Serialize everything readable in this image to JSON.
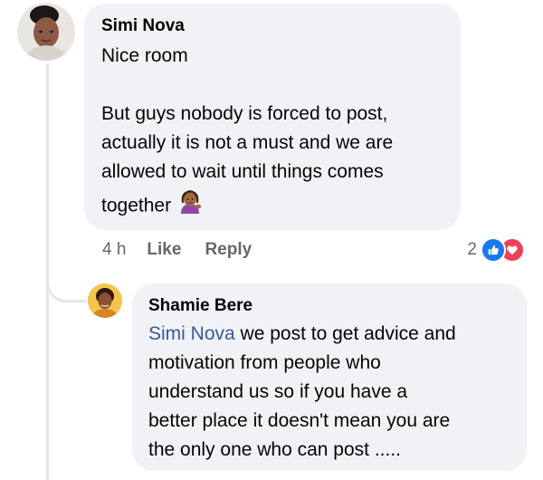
{
  "comments": [
    {
      "author": "Simi Nova",
      "lines": [
        "Nice room",
        "",
        "But guys nobody is forced to post,",
        "actually it is not a must and we are",
        "allowed to wait until things comes",
        "together"
      ],
      "emoji": "woman-tipping-hand-emoji",
      "timestamp": "4 h",
      "like_label": "Like",
      "reply_label": "Reply",
      "reaction_count": "2",
      "reactions": [
        "like-icon",
        "love-icon"
      ]
    },
    {
      "author": "Shamie Bere",
      "mention": "Simi Nova",
      "lines": [
        " we post to get advice and",
        "motivation from people who",
        "understand us so if you have a",
        "better place it doesn't mean you are",
        "the only one who can post ....."
      ]
    }
  ],
  "colors": {
    "bubble": "#f0f2f5",
    "mention": "#385898",
    "meta_text": "#65676b",
    "like": "#1877f2",
    "love": "#f33e58",
    "thread_line": "#e4e6eb"
  }
}
